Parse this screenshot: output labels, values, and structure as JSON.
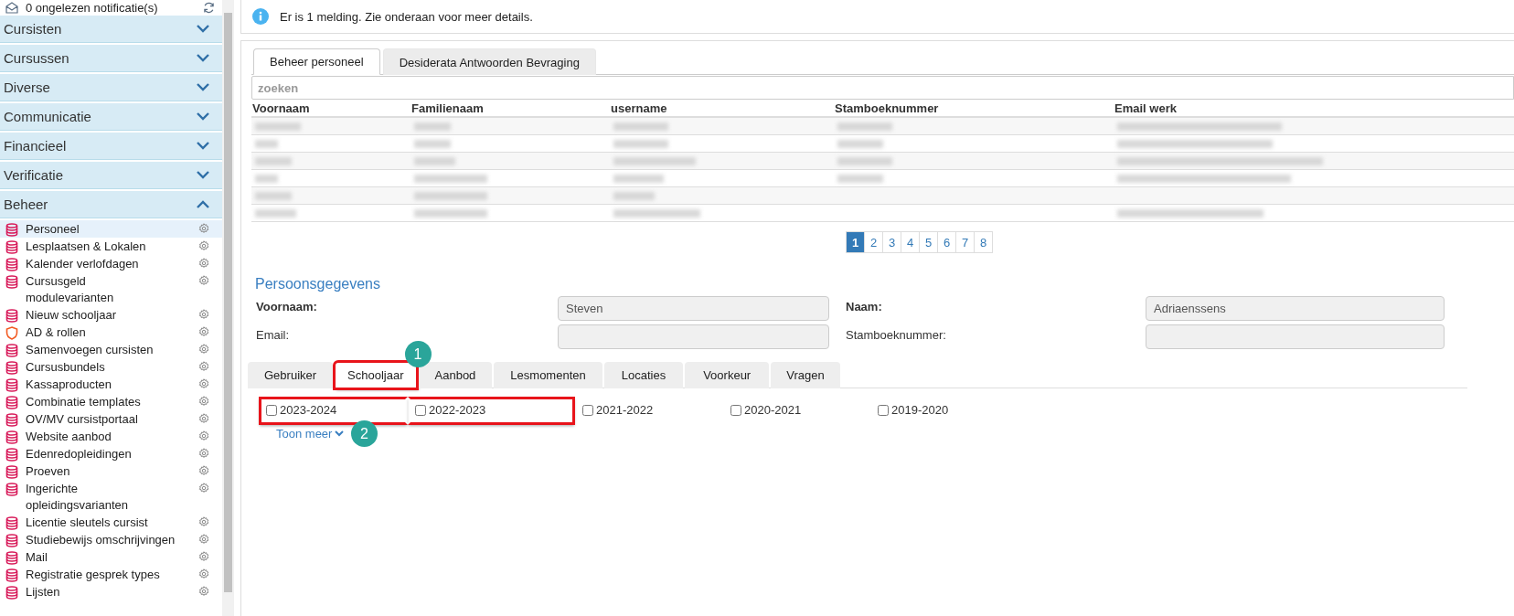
{
  "notifications": {
    "text": "0 ongelezen notificatie(s)"
  },
  "sidebar": {
    "sections": [
      {
        "title": "Cursisten",
        "expanded": false
      },
      {
        "title": "Cursussen",
        "expanded": false
      },
      {
        "title": "Diverse",
        "expanded": false
      },
      {
        "title": "Communicatie",
        "expanded": false
      },
      {
        "title": "Financieel",
        "expanded": false
      },
      {
        "title": "Verificatie",
        "expanded": false
      },
      {
        "title": "Beheer",
        "expanded": true,
        "items": [
          {
            "label": "Personeel",
            "kind": "database",
            "selected": true
          },
          {
            "label": "Lesplaatsen & Lokalen",
            "kind": "database",
            "selected": false
          },
          {
            "label": "Kalender verlofdagen",
            "kind": "database",
            "selected": false
          },
          {
            "label": "Cursusgeld modulevarianten",
            "kind": "database",
            "selected": false
          },
          {
            "label": "Nieuw schooljaar",
            "kind": "database",
            "selected": false
          },
          {
            "label": "AD & rollen",
            "kind": "shield",
            "selected": false
          },
          {
            "label": "Samenvoegen cursisten",
            "kind": "database",
            "selected": false
          },
          {
            "label": "Cursusbundels",
            "kind": "database",
            "selected": false
          },
          {
            "label": "Kassaproducten",
            "kind": "database",
            "selected": false
          },
          {
            "label": "Combinatie templates",
            "kind": "database",
            "selected": false
          },
          {
            "label": "OV/MV cursistportaal",
            "kind": "database",
            "selected": false
          },
          {
            "label": "Website aanbod",
            "kind": "database",
            "selected": false
          },
          {
            "label": "Edenredopleidingen",
            "kind": "database",
            "selected": false
          },
          {
            "label": "Proeven",
            "kind": "database",
            "selected": false
          },
          {
            "label": "Ingerichte opleidingsvarianten",
            "kind": "database",
            "selected": false
          },
          {
            "label": "Licentie sleutels cursist",
            "kind": "database",
            "selected": false
          },
          {
            "label": "Studiebewijs omschrijvingen",
            "kind": "database",
            "selected": false
          },
          {
            "label": "Mail",
            "kind": "database",
            "selected": false
          },
          {
            "label": "Registratie gesprek types",
            "kind": "database",
            "selected": false
          },
          {
            "label": "Lijsten",
            "kind": "database",
            "selected": false
          }
        ]
      }
    ]
  },
  "alert": {
    "text": "Er is 1 melding. Zie onderaan voor meer details."
  },
  "tabs": [
    {
      "label": "Beheer personeel",
      "selected": true
    },
    {
      "label": "Desiderata Antwoorden Bevraging",
      "selected": false
    }
  ],
  "search": {
    "placeholder": "zoeken"
  },
  "table": {
    "columns": [
      "Voornaam",
      "Familienaam",
      "username",
      "Stamboeknummer",
      "Email werk"
    ]
  },
  "pagination": [
    {
      "label": "1",
      "selected": true
    },
    {
      "label": "2",
      "selected": false
    },
    {
      "label": "3",
      "selected": false
    },
    {
      "label": "4",
      "selected": false
    },
    {
      "label": "5",
      "selected": false
    },
    {
      "label": "6",
      "selected": false
    },
    {
      "label": "7",
      "selected": false
    },
    {
      "label": "8",
      "selected": false
    }
  ],
  "details": {
    "title": "Persoonsgegevens",
    "fields": [
      {
        "label": "Voornaam:",
        "value": "Steven",
        "bold": true
      },
      {
        "label": "Naam:",
        "value": "Adriaenssens",
        "bold": true
      },
      {
        "label": "Email:",
        "bold": false
      },
      {
        "label": "Stamboeknummer:",
        "bold": false
      }
    ],
    "tabs": [
      {
        "label": "Gebruiker",
        "selected": false
      },
      {
        "label": "Schooljaar",
        "selected": true,
        "callout": "1"
      },
      {
        "label": "Aanbod",
        "selected": false
      },
      {
        "label": "Lesmomenten",
        "selected": false
      },
      {
        "label": "Locaties",
        "selected": false
      },
      {
        "label": "Voorkeur",
        "selected": false
      },
      {
        "label": "Vragen",
        "selected": false
      }
    ],
    "years": {
      "callout": "2",
      "items": [
        {
          "label": "2023-2024",
          "checked": false,
          "highlighted": true
        },
        {
          "label": "2022-2023",
          "checked": false,
          "highlighted": true
        },
        {
          "label": "2021-2022",
          "checked": false,
          "highlighted": false
        },
        {
          "label": "2020-2021",
          "checked": false,
          "highlighted": false
        },
        {
          "label": "2019-2020",
          "checked": false,
          "highlighted": false
        }
      ]
    },
    "more_link": "Toon meer"
  }
}
